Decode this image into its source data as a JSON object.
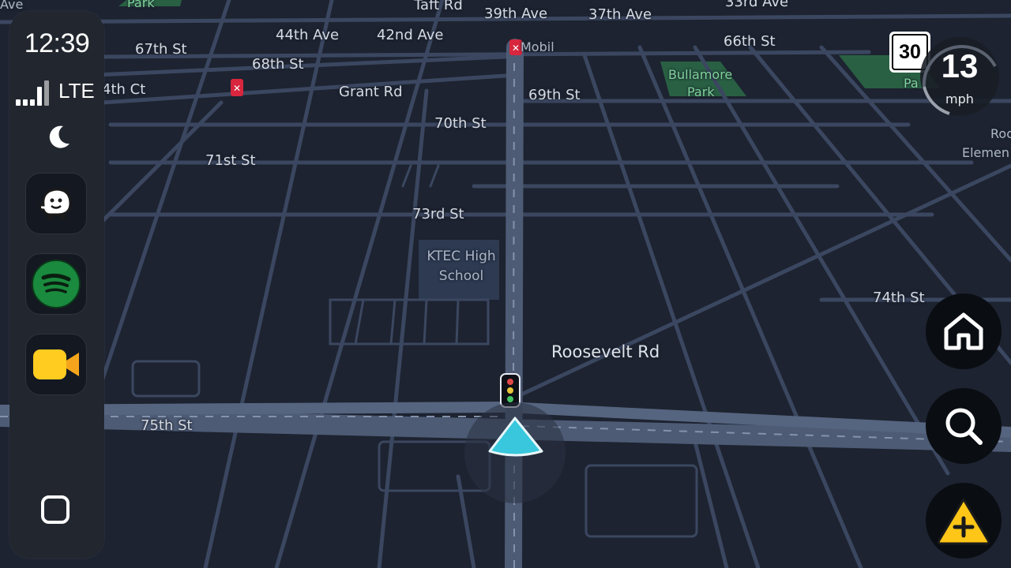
{
  "status": {
    "time": "12:39",
    "network": "LTE"
  },
  "dock": {
    "apps": [
      {
        "name": "Waze",
        "icon": "waze-icon"
      },
      {
        "name": "Spotify",
        "icon": "spotify-icon"
      },
      {
        "name": "Video",
        "icon": "video-camera-icon"
      }
    ]
  },
  "speed": {
    "limit": "30",
    "current": "13",
    "unit": "mph"
  },
  "map": {
    "labels": {
      "top_left_cut": "Ave",
      "park_top": "Park",
      "taft_rd": "Taft Rd",
      "top_right_cut": "33rd Ave",
      "st_67": "67th St",
      "ave_44": "44th Ave",
      "ave_42": "42nd Ave",
      "ave_39": "39th Ave",
      "ave_37": "37th Ave",
      "mobil": "Mobil",
      "st_66": "66th St",
      "st_68": "68th St",
      "ct_4": "4th Ct",
      "grant_rd": "Grant Rd",
      "st_69": "69th St",
      "bullamore": "Bullamore",
      "bullamore_park": "Park",
      "pa_cut": "Pa",
      "st_70": "70th St",
      "st_71": "71st St",
      "roo_cut": "Roo",
      "elemen_cut": "Elemen",
      "st_73": "73rd St",
      "school_line1": "KTEC High",
      "school_line2": "School",
      "st_74": "74th St",
      "roosevelt": "Roosevelt Rd",
      "st_75": "75th St"
    }
  },
  "colors": {
    "map_background": "#1d2330",
    "road": "#3d4a60",
    "route": "#34c3d9",
    "park": "#2e7d4f"
  }
}
